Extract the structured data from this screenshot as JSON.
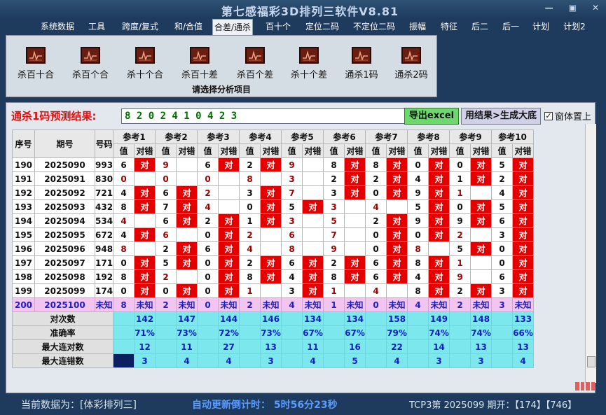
{
  "window": {
    "title": "第七感福彩3D排列三软件V8.81",
    "min_label": "—",
    "restore_label": "▣",
    "close_label": "✕"
  },
  "menu": [
    "系统数据",
    "工具",
    "跨度/复式",
    "和/合值",
    "合差/通杀",
    "百十个",
    "定位二码",
    "不定位二码",
    "振幅",
    "特征",
    "后二",
    "后一",
    "计划",
    "计划2"
  ],
  "ribbon": {
    "buttons": [
      "杀百十合",
      "杀百个合",
      "杀十个合",
      "杀百十差",
      "杀百个差",
      "杀十个差",
      "通杀1码",
      "通杀2码"
    ],
    "group_label": "请选择分析项目"
  },
  "prediction": {
    "label": "通杀1码预测结果:",
    "value": "8 2 0 2 4 1 0 4 2 3"
  },
  "actions": {
    "export_label": "导出excel",
    "generate_label": "用结果>生成大底",
    "topmost_label": "窗体置上",
    "topmost_checked": "✓"
  },
  "table": {
    "col_seq": "序号",
    "col_period": "期号",
    "col_number": "号码",
    "ref_headers": [
      "参考1",
      "参考2",
      "参考3",
      "参考4",
      "参考5",
      "参考6",
      "参考7",
      "参考8",
      "参考9",
      "参考10"
    ],
    "sub_value": "值",
    "sub_result": "对错",
    "hit_text": "对",
    "rows": [
      {
        "seq": "190",
        "period": "2025090",
        "num": "993",
        "vals": [
          "6",
          "9",
          "6",
          "2",
          "9",
          "8",
          "8",
          "0",
          "0",
          "5"
        ],
        "hits": [
          1,
          0,
          1,
          1,
          0,
          1,
          1,
          1,
          1,
          1
        ]
      },
      {
        "seq": "191",
        "period": "2025091",
        "num": "830",
        "vals": [
          "0",
          "0",
          "0",
          "8",
          "3",
          "2",
          "2",
          "4",
          "1",
          "2"
        ],
        "hits": [
          0,
          0,
          0,
          0,
          0,
          1,
          1,
          1,
          1,
          1
        ]
      },
      {
        "seq": "192",
        "period": "2025092",
        "num": "721",
        "vals": [
          "4",
          "6",
          "2",
          "3",
          "7",
          "3",
          "0",
          "9",
          "1",
          "4"
        ],
        "hits": [
          1,
          1,
          0,
          1,
          0,
          1,
          1,
          1,
          0,
          1
        ]
      },
      {
        "seq": "193",
        "period": "2025093",
        "num": "432",
        "vals": [
          "8",
          "7",
          "4",
          "0",
          "5",
          "3",
          "4",
          "5",
          "0",
          "5"
        ],
        "hits": [
          1,
          1,
          0,
          1,
          1,
          0,
          0,
          1,
          1,
          1
        ]
      },
      {
        "seq": "194",
        "period": "2025094",
        "num": "534",
        "vals": [
          "4",
          "6",
          "2",
          "1",
          "3",
          "5",
          "2",
          "9",
          "9",
          "6"
        ],
        "hits": [
          0,
          1,
          1,
          1,
          0,
          0,
          1,
          1,
          1,
          1
        ]
      },
      {
        "seq": "195",
        "period": "2025095",
        "num": "672",
        "vals": [
          "4",
          "6",
          "0",
          "2",
          "6",
          "7",
          "0",
          "0",
          "2",
          "3"
        ],
        "hits": [
          1,
          0,
          1,
          0,
          0,
          0,
          1,
          1,
          0,
          1
        ]
      },
      {
        "seq": "196",
        "period": "2025096",
        "num": "948",
        "vals": [
          "8",
          "2",
          "6",
          "4",
          "8",
          "9",
          "0",
          "8",
          "5",
          "0"
        ],
        "hits": [
          0,
          1,
          1,
          0,
          0,
          0,
          1,
          0,
          1,
          1
        ]
      },
      {
        "seq": "197",
        "period": "2025097",
        "num": "171",
        "vals": [
          "0",
          "5",
          "0",
          "2",
          "6",
          "2",
          "6",
          "8",
          "1",
          "0"
        ],
        "hits": [
          1,
          1,
          1,
          1,
          1,
          1,
          1,
          1,
          0,
          1
        ]
      },
      {
        "seq": "198",
        "period": "2025098",
        "num": "192",
        "vals": [
          "8",
          "2",
          "0",
          "8",
          "4",
          "8",
          "6",
          "4",
          "9",
          "6"
        ],
        "hits": [
          1,
          0,
          1,
          1,
          1,
          1,
          1,
          1,
          0,
          1
        ]
      },
      {
        "seq": "199",
        "period": "2025099",
        "num": "174",
        "vals": [
          "0",
          "0",
          "0",
          "1",
          "3",
          "1",
          "4",
          "8",
          "2",
          "3"
        ],
        "hits": [
          1,
          1,
          1,
          0,
          1,
          0,
          0,
          1,
          1,
          1
        ]
      }
    ],
    "predict_row": {
      "seq": "200",
      "period": "2025100",
      "num": "未知",
      "vals": [
        "8",
        "2",
        "0",
        "2",
        "4",
        "1",
        "0",
        "4",
        "2",
        "3"
      ],
      "result_text": "未知"
    },
    "stats": [
      {
        "label": "对次数",
        "values": [
          "142",
          "147",
          "144",
          "146",
          "134",
          "134",
          "158",
          "149",
          "148",
          "133"
        ]
      },
      {
        "label": "准确率",
        "values": [
          "71%",
          "73%",
          "72%",
          "73%",
          "67%",
          "67%",
          "79%",
          "74%",
          "74%",
          "66%"
        ]
      },
      {
        "label": "最大连对数",
        "values": [
          "12",
          "11",
          "27",
          "13",
          "11",
          "16",
          "22",
          "14",
          "13",
          "13"
        ]
      },
      {
        "label": "最大连错数",
        "values": [
          "3",
          "4",
          "4",
          "3",
          "4",
          "5",
          "4",
          "3",
          "3",
          "4"
        ]
      }
    ]
  },
  "status": {
    "data_source": "当前数据为：[体彩排列三]",
    "countdown": "自动更新倒计时：  5时56分23秒",
    "latest": "TCP3第 2025099 期开：【174】【746】"
  },
  "colors": {
    "hit": "#e40000",
    "predict_row": "#f2c4f0",
    "stat_row": "#7ce8ee",
    "background": "#1e3a5c"
  }
}
